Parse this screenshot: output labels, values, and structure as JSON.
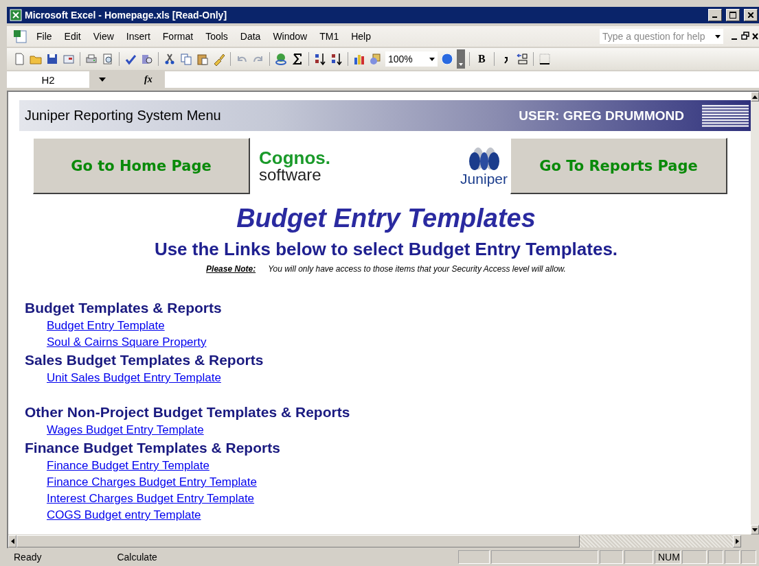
{
  "window": {
    "title": "Microsoft Excel - Homepage.xls  [Read-Only]"
  },
  "menu": {
    "items": [
      "File",
      "Edit",
      "View",
      "Insert",
      "Format",
      "Tools",
      "Data",
      "Window",
      "TM1",
      "Help"
    ],
    "help_placeholder": "Type a question for help"
  },
  "toolbar": {
    "zoom": "100%",
    "bold": "B"
  },
  "formula_bar": {
    "name_box": "H2",
    "fx": "fx"
  },
  "sheet": {
    "banner": {
      "title": "Juniper Reporting System Menu",
      "user": "USER: GREG DRUMMOND"
    },
    "buttons": [
      "Go to Home Page",
      "Go To Reports Page"
    ],
    "cognos": {
      "name": "Cognos.",
      "tagline": "software"
    },
    "juniper": "Juniper",
    "heading": "Budget Entry Templates",
    "subheading": "Use the Links below to select Budget Entry Templates.",
    "note": {
      "label": "Please Note:",
      "text": "You will only have access to those items that your Security Access level will allow."
    },
    "sections": [
      {
        "title": "Budget Templates & Reports",
        "links": [
          "Budget Entry Template",
          "Soul & Cairns Square Property"
        ]
      },
      {
        "title": "Sales Budget Templates & Reports",
        "links": [
          "Unit Sales Budget Entry Template"
        ]
      },
      {
        "title": "Other Non-Project Budget Templates & Reports",
        "links": [
          "Wages Budget Entry Template"
        ]
      },
      {
        "title": "Finance Budget Templates & Reports",
        "links": [
          "Finance Budget Entry Template",
          "Finance Charges Budget Entry Template",
          "Interest Charges Budget Entry Template",
          "COGS Budget entry Template"
        ]
      }
    ]
  },
  "status_bar": {
    "mode": "Ready",
    "calc": "Calculate",
    "num": "NUM"
  }
}
